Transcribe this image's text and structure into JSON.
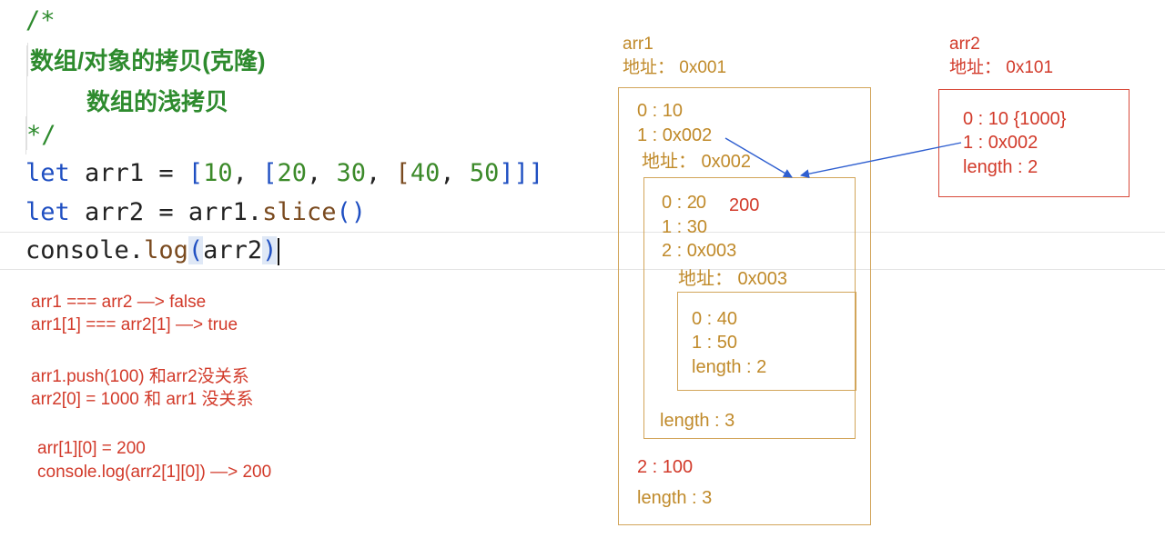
{
  "editor": {
    "comment_open": "/*",
    "comment_line1": " 数组/对象的拷贝(克隆)",
    "comment_line2": "数组的浅拷贝",
    "comment_close": " */",
    "line1": {
      "kw": "let",
      "name": "arr1",
      "eq": "=",
      "open1": "[",
      "n10": "10",
      "c1": ",",
      "open2": "[",
      "n20": "20",
      "c2": ",",
      "n30": "30",
      "c3": ",",
      "open3": "[",
      "n40": "40",
      "c4": ",",
      "n50": "50",
      "close": "]]]"
    },
    "line2": {
      "kw": "let",
      "name": "arr2",
      "eq": "=",
      "obj": "arr1",
      "dot": ".",
      "fn": "slice",
      "parens": "()"
    },
    "line3": {
      "obj": "console",
      "dot": ".",
      "fn": "log",
      "open": "(",
      "arg": "arr2",
      "close": ")"
    }
  },
  "notes": [
    "arr1 === arr2   —> false",
    "arr1[1] === arr2[1]  —> true",
    "arr1.push(100)   和arr2没关系",
    "arr2[0] = 1000  和 arr1 没关系",
    "arr[1][0] = 200",
    "console.log(arr2[1][0])  —> 200"
  ],
  "diagram": {
    "arr1": {
      "name": "arr1",
      "addr": "地址：  0x001",
      "i0": "0 : 10",
      "i1": "1 : 0x002",
      "i2": "2 : 100",
      "length": "length : 3"
    },
    "inner": {
      "addr": "地址：  0x002",
      "i0": "0 : 2",
      "i0_strike": "0",
      "i0_new": "200",
      "i1": "1 : 30",
      "i2": "2 : 0x003",
      "length": "length : 3"
    },
    "deep": {
      "addr": "地址：  0x003",
      "i0": "0 : 40",
      "i1": "1 : 50",
      "length": "length : 2"
    },
    "arr2": {
      "name": "arr2",
      "addr": "地址：  0x101",
      "i0": "0 : 10 {1000}",
      "i1": "1 : 0x002",
      "length": "length : 2"
    }
  },
  "colors": {
    "comment": "#2e8b2e",
    "keyword": "#1f4fc2",
    "number": "#3c8a2a",
    "red": "#d23a2a",
    "gold": "#c08a2a",
    "arrow": "#2f5fd0"
  }
}
